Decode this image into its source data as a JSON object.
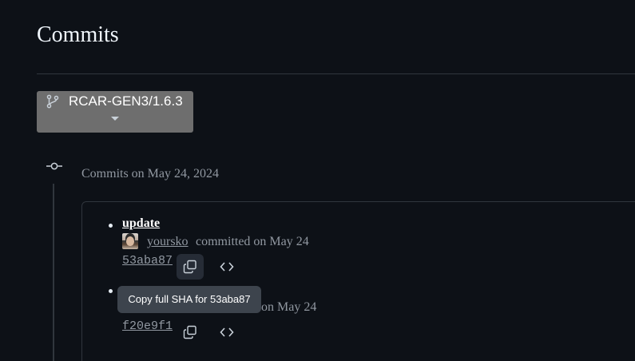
{
  "page": {
    "title": "Commits"
  },
  "branch": {
    "name": "RCAR-GEN3/1.6.3",
    "icon": "git-branch-icon"
  },
  "group": {
    "date_label": "Commits on May 24, 2024",
    "icon": "git-commit-icon"
  },
  "commits": [
    {
      "message": "update",
      "author": "yoursko",
      "committed_text": "committed on May 24",
      "sha": "53aba87",
      "copy_icon": "copy-icon",
      "browse_icon": "code-icon"
    },
    {
      "message": "",
      "author": "",
      "committed_text": "on May 24",
      "sha": "f20e9f1",
      "copy_icon": "copy-icon",
      "browse_icon": "code-icon"
    }
  ],
  "tooltip": {
    "text": "Copy full SHA for 53aba87"
  },
  "colors": {
    "background": "#0d1117",
    "branch_button": "#6e6e6e",
    "muted_text": "#9198a1",
    "border": "#30363d",
    "tooltip_bg": "#3d444d"
  }
}
